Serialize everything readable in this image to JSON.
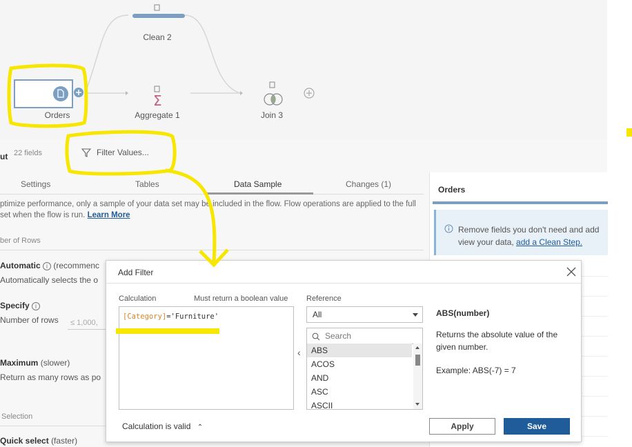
{
  "flow": {
    "nodes": {
      "clean2": {
        "label": "Clean 2",
        "icon": "clean-step-icon"
      },
      "orders": {
        "label": "Orders",
        "icon": "input-file-icon"
      },
      "aggregate1": {
        "label": "Aggregate 1",
        "icon": "sigma-icon"
      },
      "join3": {
        "label": "Join 3",
        "icon": "join-icon"
      }
    },
    "add_icon": "plus-icon"
  },
  "panel": {
    "fields_title": "ut",
    "fields_count": "22 fields",
    "filter_label": "Filter Values...",
    "tabs": [
      {
        "label": "Settings",
        "active": false
      },
      {
        "label": "Tables",
        "active": false
      },
      {
        "label": "Data Sample",
        "active": true
      },
      {
        "label": "Changes (1)",
        "active": false
      }
    ],
    "description_line1": "ptimize performance, only a sample of your data set may be included in the flow. Flow operations are applied to the full",
    "description_line2": " set when the flow is run.",
    "learn_more": "Learn More",
    "rows_section": "ber of Rows",
    "automatic_title": "Automatic",
    "automatic_suffix": "(recommenc",
    "automatic_sub": "Automatically selects the o",
    "specify_title": "Specify",
    "specify_sub": "Number of rows",
    "rows_placeholder": "≤ 1,000,",
    "maximum_title": "Maximum",
    "maximum_suffix": "(slower)",
    "maximum_sub": "Return as many rows as po",
    "selection_section": "Selection",
    "quick_select_title": "Quick select",
    "quick_select_suffix": "(faster)"
  },
  "orders_panel": {
    "title": "Orders",
    "note_line1": "Remove fields you don't need and add",
    "note_line2_prefix": "view your data, ",
    "note_link": "add a Clean Step."
  },
  "dialog": {
    "title": "Add Filter",
    "calc_label": "Calculation",
    "calc_hint": "Must return a boolean value",
    "calc_field": "[Category]",
    "calc_rest": "='Furniture'",
    "reference_label": "Reference",
    "reference_selected": "All",
    "search_placeholder": "Search",
    "functions": [
      "ABS",
      "ACOS",
      "AND",
      "ASC",
      "ASCII"
    ],
    "selected_function": "ABS",
    "fn_signature": "ABS(number)",
    "fn_description": "Returns the absolute value of the given number.",
    "fn_example": "Example: ABS(-7) = 7",
    "valid_text": "Calculation is valid",
    "apply_label": "Apply",
    "save_label": "Save"
  },
  "colors": {
    "primary": "#1f5c99",
    "annotation_yellow": "#f7e600",
    "node_bar": "#7c9ec0",
    "sigma": "#c0627d",
    "calc_field": "#d9822b"
  }
}
